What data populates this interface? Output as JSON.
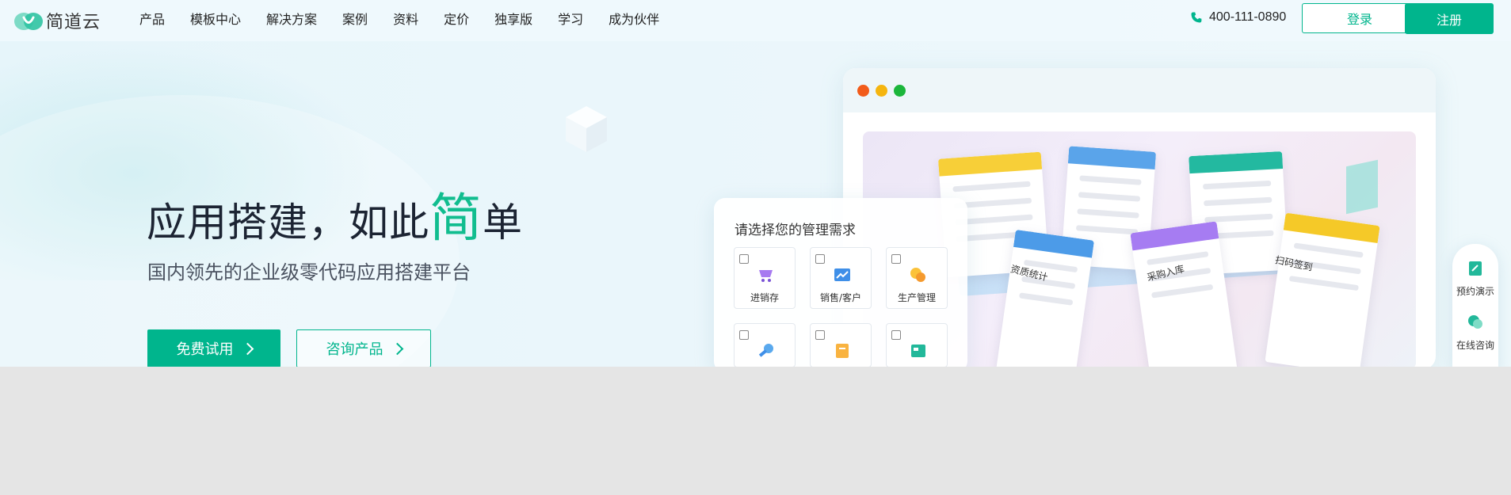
{
  "brand": {
    "logo_text": "简道云",
    "accent_color": "#00b58d",
    "icon": "leaf-heart-logo"
  },
  "nav": {
    "items": [
      {
        "label": "产品"
      },
      {
        "label": "模板中心"
      },
      {
        "label": "解决方案"
      },
      {
        "label": "案例"
      },
      {
        "label": "资料"
      },
      {
        "label": "定价"
      },
      {
        "label": "独享版"
      },
      {
        "label": "学习"
      },
      {
        "label": "成为伙伴"
      }
    ],
    "phone": "400-111-0890",
    "phone_icon": "phone-icon",
    "login_label": "登录",
    "register_label": "注册"
  },
  "hero": {
    "headline_part1": "应用搭建，如此",
    "headline_accent": "简",
    "headline_part2": "单",
    "subtitle": "国内领先的企业级零代码应用搭建平台",
    "trial_button": "免费试用",
    "consult_button": "咨询产品"
  },
  "illustration": {
    "window_dot_colors": [
      "#f25b1a",
      "#f5b50f",
      "#1bb63b"
    ],
    "cards": [
      {
        "label": "资质统计",
        "color": "#4c9be8"
      },
      {
        "label": "采购入库",
        "color": "#a67cf2"
      },
      {
        "label": "扫码签到",
        "color": "#f5c928"
      }
    ]
  },
  "needs_panel": {
    "title": "请选择您的管理需求",
    "options": [
      {
        "label": "进销存",
        "icon": "cart-icon"
      },
      {
        "label": "销售/客户",
        "icon": "chart-icon"
      },
      {
        "label": "生产管理",
        "icon": "production-icon"
      },
      {
        "label": "",
        "icon": "key-icon"
      },
      {
        "label": "",
        "icon": "document-icon"
      },
      {
        "label": "",
        "icon": "sheet-icon"
      }
    ]
  },
  "side_widget": {
    "demo_label": "预约演示",
    "chat_label": "在线咨询"
  }
}
